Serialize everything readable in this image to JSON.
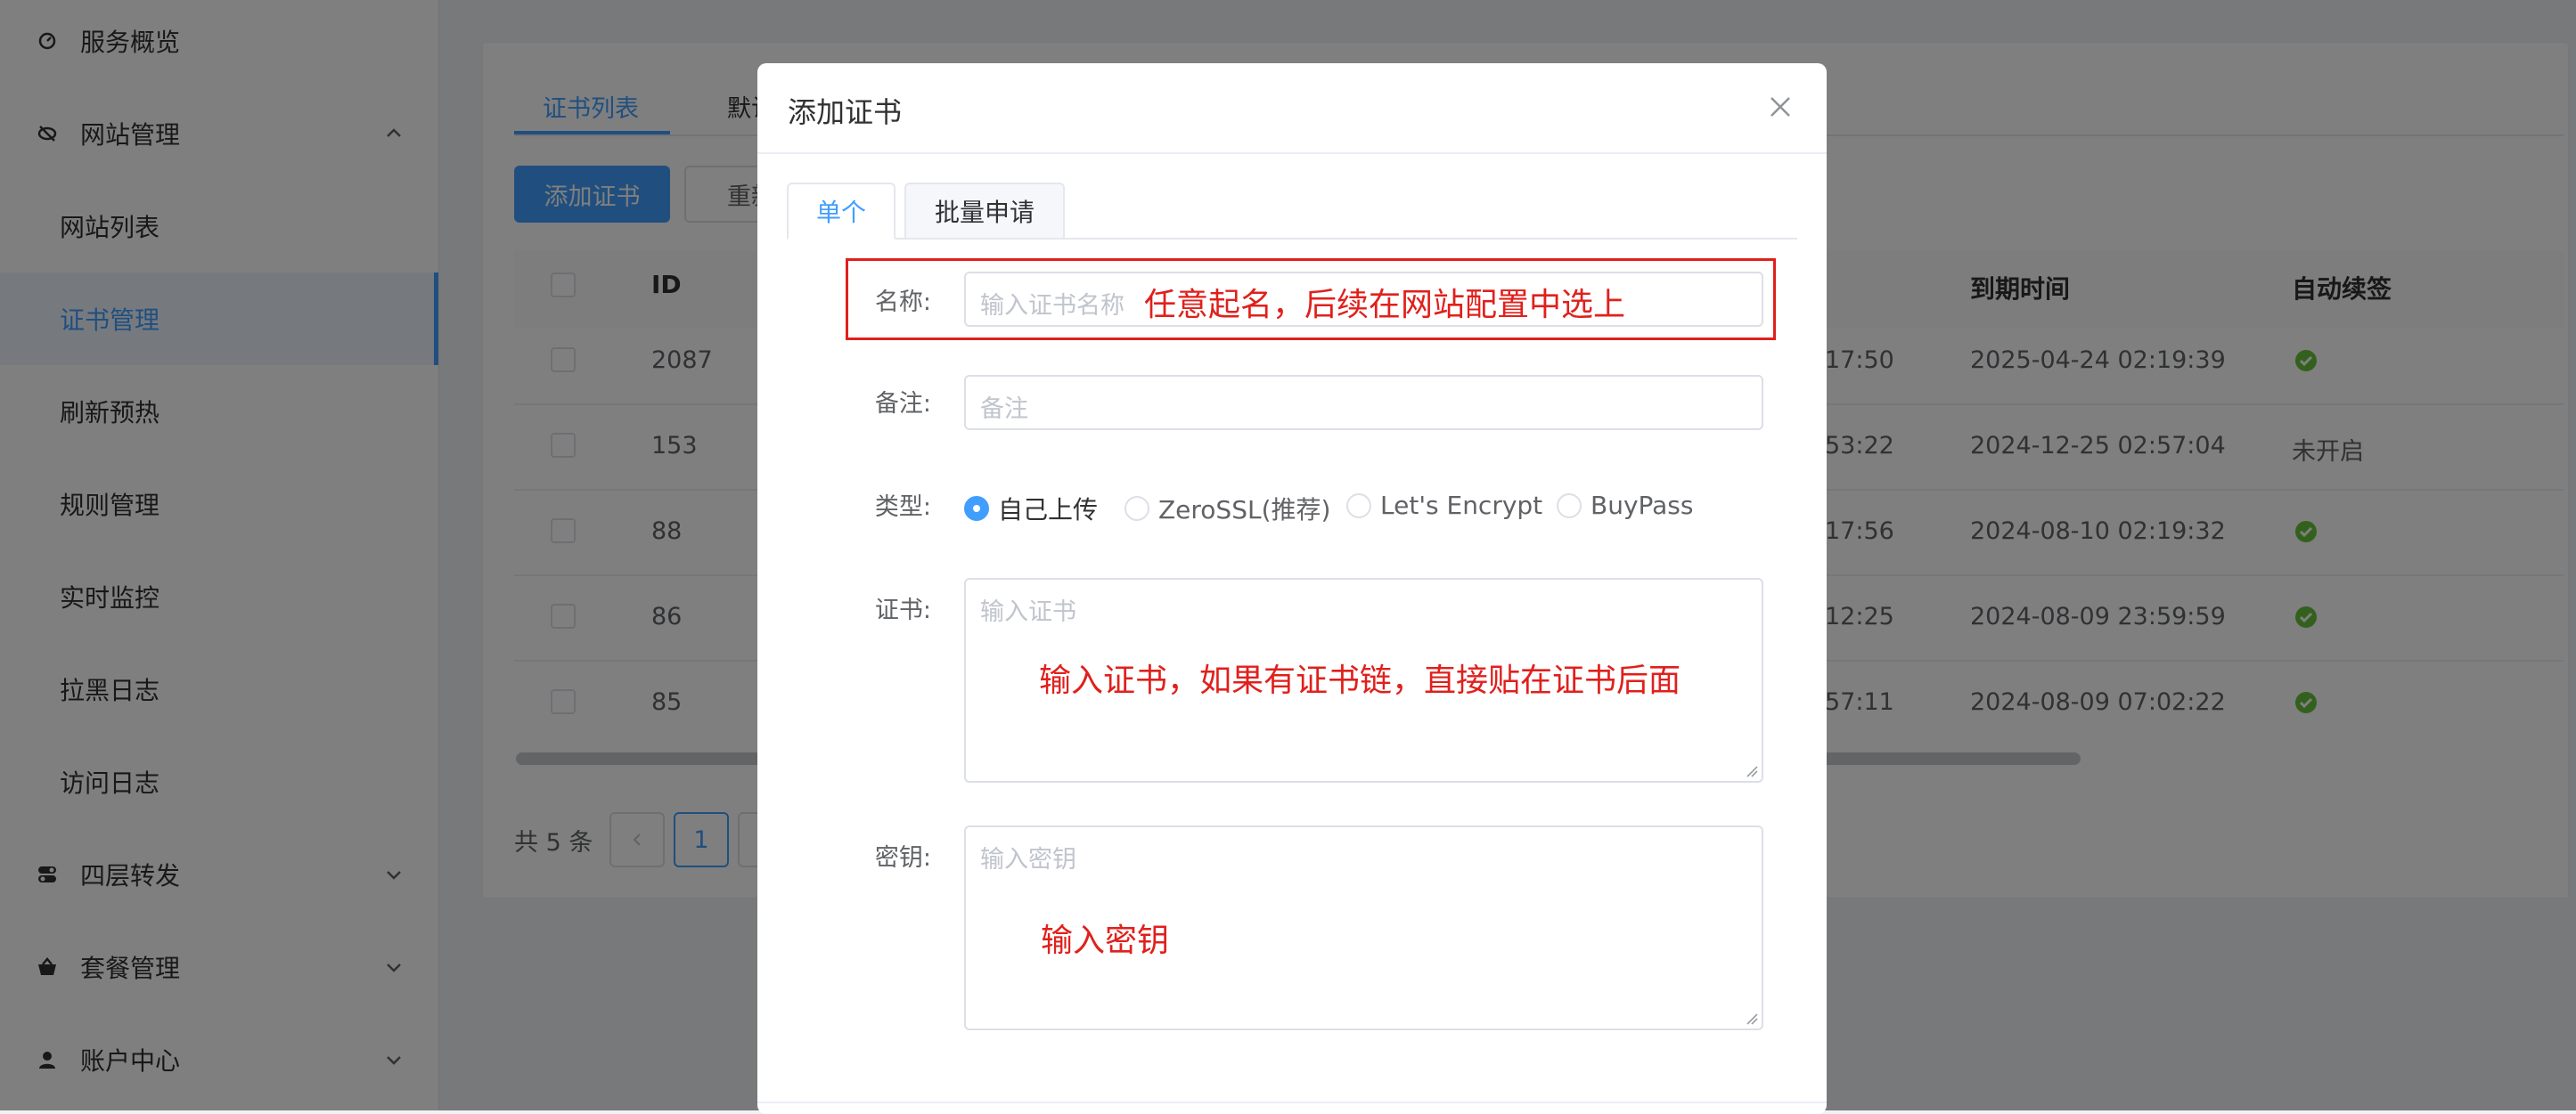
{
  "sidebar": {
    "items": [
      {
        "label": "服务概览",
        "icon": "dashboard-icon",
        "kind": "top"
      },
      {
        "label": "网站管理",
        "icon": "eye-slash-icon",
        "kind": "top",
        "expanded": true
      },
      {
        "label": "网站列表",
        "kind": "sub"
      },
      {
        "label": "证书管理",
        "kind": "sub",
        "active": true
      },
      {
        "label": "刷新预热",
        "kind": "sub"
      },
      {
        "label": "规则管理",
        "kind": "sub"
      },
      {
        "label": "实时监控",
        "kind": "sub"
      },
      {
        "label": "拉黑日志",
        "kind": "sub"
      },
      {
        "label": "访问日志",
        "kind": "sub"
      },
      {
        "label": "四层转发",
        "icon": "toggle-icon",
        "kind": "top",
        "expanded": false
      },
      {
        "label": "套餐管理",
        "icon": "basket-icon",
        "kind": "top",
        "expanded": false
      },
      {
        "label": "账户中心",
        "icon": "user-icon",
        "kind": "top",
        "expanded": false
      }
    ]
  },
  "main": {
    "tabs": [
      {
        "label": "证书列表",
        "active": true
      },
      {
        "label": "默认"
      }
    ],
    "buttons": {
      "add": "添加证书",
      "refresh": "重新"
    },
    "table": {
      "headers": {
        "id": "ID",
        "expire": "到期时间",
        "auto_renew": "自动续签"
      },
      "rows": [
        {
          "id": "2087",
          "time_part": "17:50",
          "expire": "2025-04-24 02:19:39",
          "auto_renew": "check"
        },
        {
          "id": "153",
          "time_part": "53:22",
          "expire": "2024-12-25 02:57:04",
          "auto_renew": "未开启"
        },
        {
          "id": "88",
          "time_part": "17:56",
          "expire": "2024-08-10 02:19:32",
          "auto_renew": "check"
        },
        {
          "id": "86",
          "time_part": "12:25",
          "expire": "2024-08-09 23:59:59",
          "auto_renew": "check"
        },
        {
          "id": "85",
          "time_part": "57:11",
          "expire": "2024-08-09 07:02:22",
          "auto_renew": "check"
        }
      ]
    },
    "pagination": {
      "total": "共 5 条",
      "current_page": "1"
    }
  },
  "dialog": {
    "title": "添加证书",
    "tabs": [
      {
        "label": "单个",
        "active": true
      },
      {
        "label": "批量申请"
      }
    ],
    "form": {
      "name": {
        "label": "名称:",
        "placeholder": "输入证书名称",
        "annotation": "任意起名，后续在网站配置中选上"
      },
      "remark": {
        "label": "备注:",
        "placeholder": "备注"
      },
      "type": {
        "label": "类型:",
        "options": [
          "自己上传",
          "ZeroSSL(推荐)",
          "Let's Encrypt",
          "BuyPass"
        ],
        "selected": "自己上传"
      },
      "cert": {
        "label": "证书:",
        "placeholder": "输入证书",
        "annotation": "输入证书，如果有证书链，直接贴在证书后面"
      },
      "key": {
        "label": "密钥:",
        "placeholder": "输入密钥",
        "annotation": "输入密钥"
      }
    }
  },
  "colors": {
    "accent": "#409eff",
    "annotation": "#e0201c",
    "success": "#67c23a"
  }
}
